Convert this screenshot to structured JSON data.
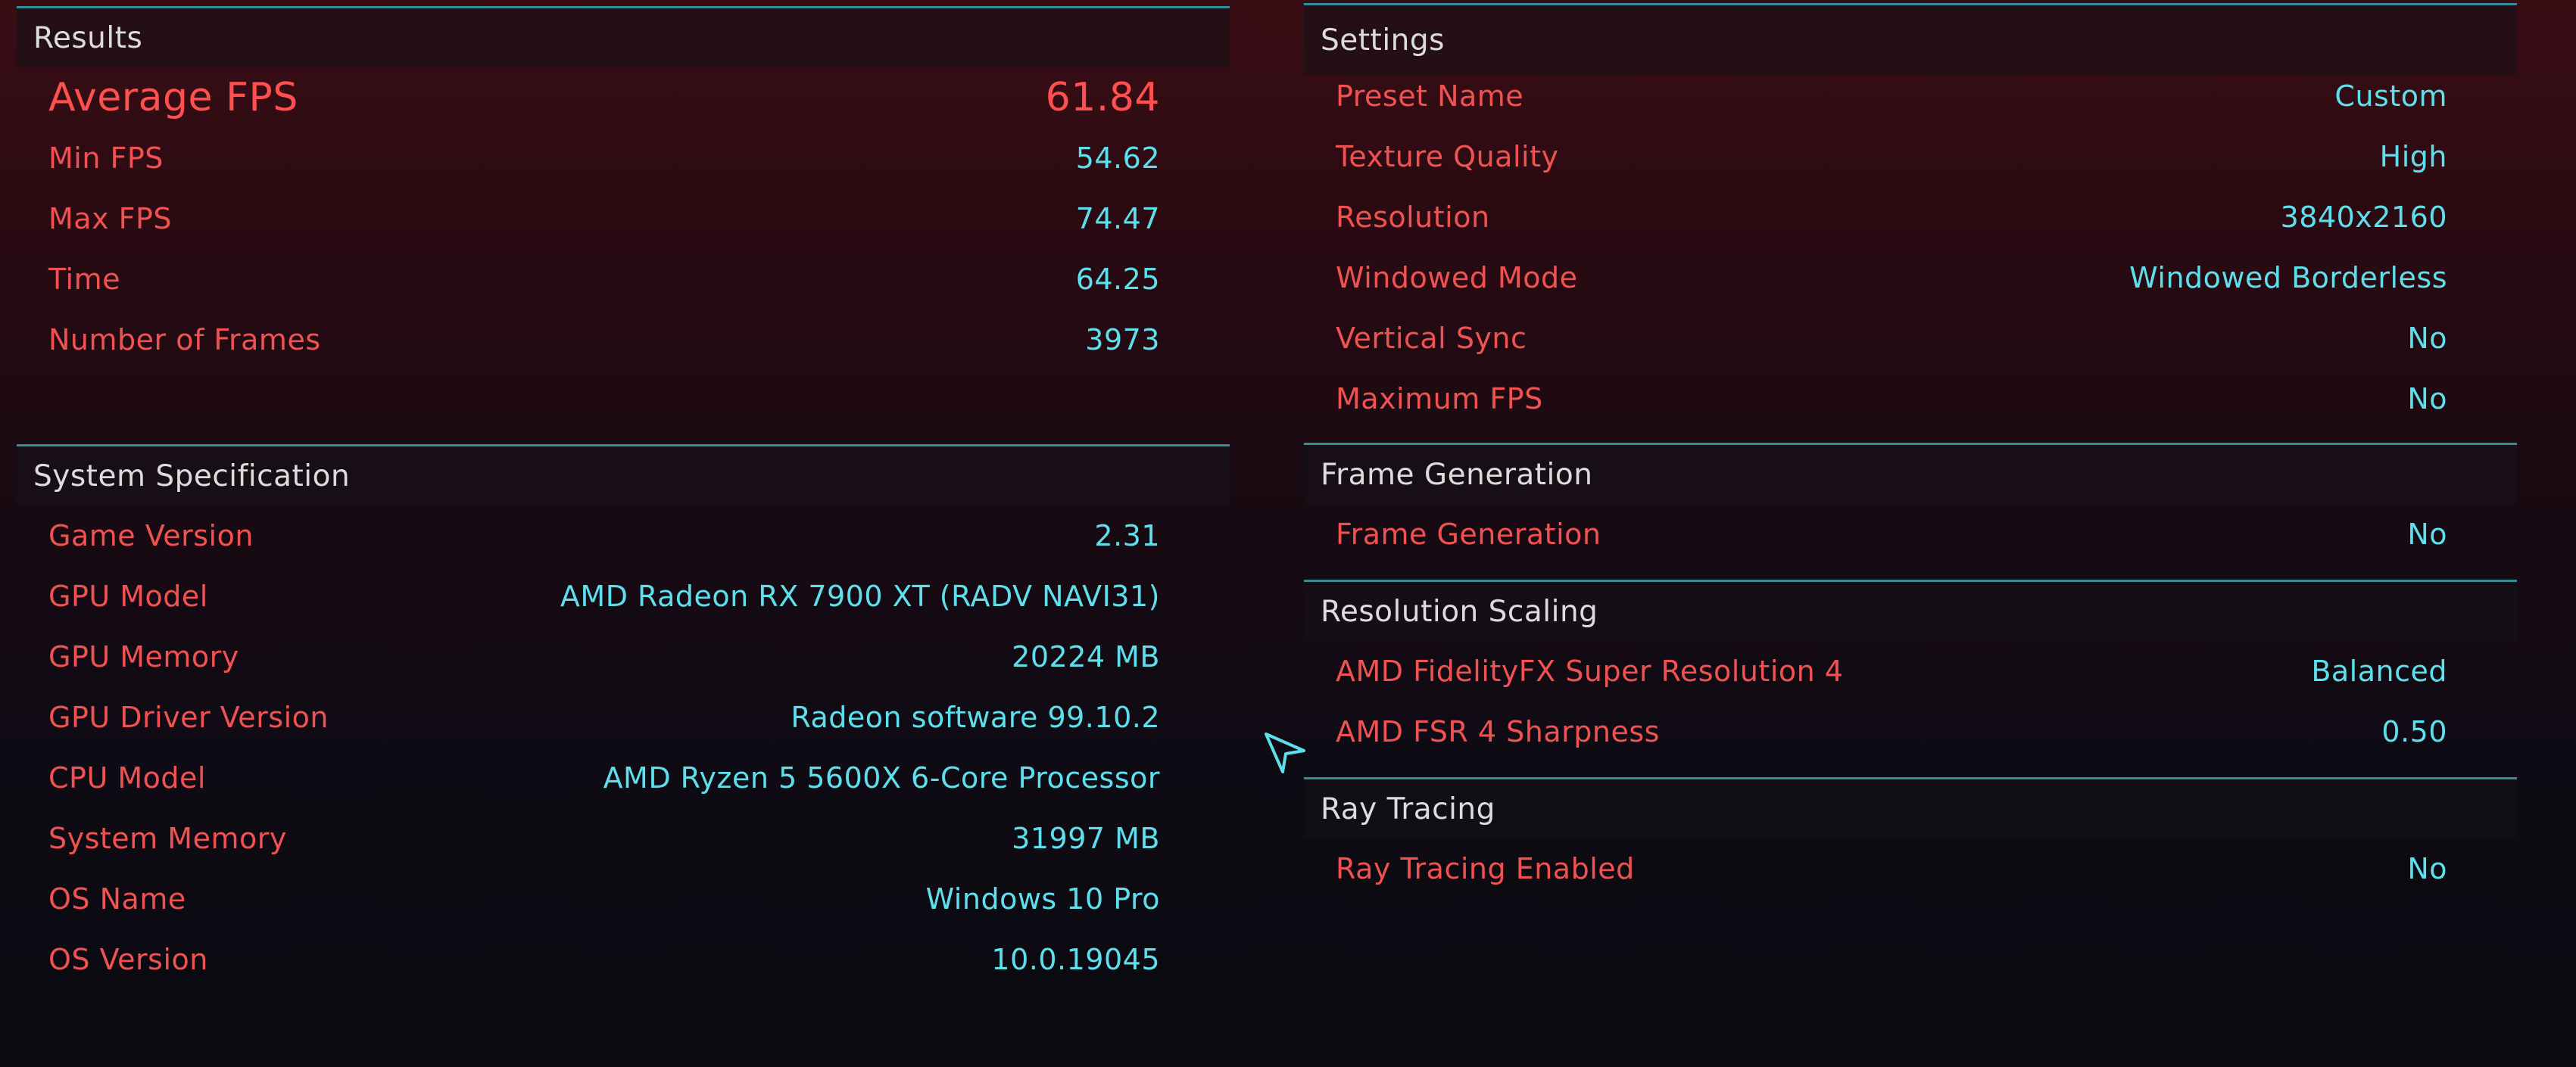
{
  "results": {
    "title": "Results",
    "average_fps": {
      "label": "Average FPS",
      "value": "61.84"
    },
    "rows": [
      {
        "label": "Min FPS",
        "value": "54.62"
      },
      {
        "label": "Max FPS",
        "value": "74.47"
      },
      {
        "label": "Time",
        "value": "64.25"
      },
      {
        "label": "Number of Frames",
        "value": "3973"
      }
    ]
  },
  "system": {
    "title": "System Specification",
    "rows": [
      {
        "label": "Game Version",
        "value": "2.31"
      },
      {
        "label": "GPU Model",
        "value": "AMD Radeon RX 7900 XT (RADV NAVI31)"
      },
      {
        "label": "GPU Memory",
        "value": "20224 MB"
      },
      {
        "label": "GPU Driver Version",
        "value": "Radeon software 99.10.2"
      },
      {
        "label": "CPU Model",
        "value": "AMD Ryzen 5 5600X 6-Core Processor"
      },
      {
        "label": "System Memory",
        "value": "31997 MB"
      },
      {
        "label": "OS Name",
        "value": "Windows 10 Pro"
      },
      {
        "label": "OS Version",
        "value": "10.0.19045"
      }
    ]
  },
  "settings": {
    "title": "Settings",
    "rows": [
      {
        "label": "Preset Name",
        "value": "Custom"
      },
      {
        "label": "Texture Quality",
        "value": "High"
      },
      {
        "label": "Resolution",
        "value": "3840x2160"
      },
      {
        "label": "Windowed Mode",
        "value": "Windowed Borderless"
      },
      {
        "label": "Vertical Sync",
        "value": "No"
      },
      {
        "label": "Maximum FPS",
        "value": "No"
      }
    ]
  },
  "frame_generation": {
    "title": "Frame Generation",
    "rows": [
      {
        "label": "Frame Generation",
        "value": "No"
      }
    ]
  },
  "resolution_scaling": {
    "title": "Resolution Scaling",
    "rows": [
      {
        "label": "AMD FidelityFX Super Resolution 4",
        "value": "Balanced"
      },
      {
        "label": "AMD FSR 4 Sharpness",
        "value": "0.50"
      }
    ]
  },
  "ray_tracing": {
    "title": "Ray Tracing",
    "rows": [
      {
        "label": "Ray Tracing Enabled",
        "value": "No"
      }
    ]
  },
  "colors": {
    "label_red": "#f05252",
    "value_cyan": "#5ee0ec",
    "divider_teal": "#2f8f99",
    "header_text": "#dcdcdc"
  },
  "icons": {
    "cursor": "pointer-arrow-icon"
  }
}
